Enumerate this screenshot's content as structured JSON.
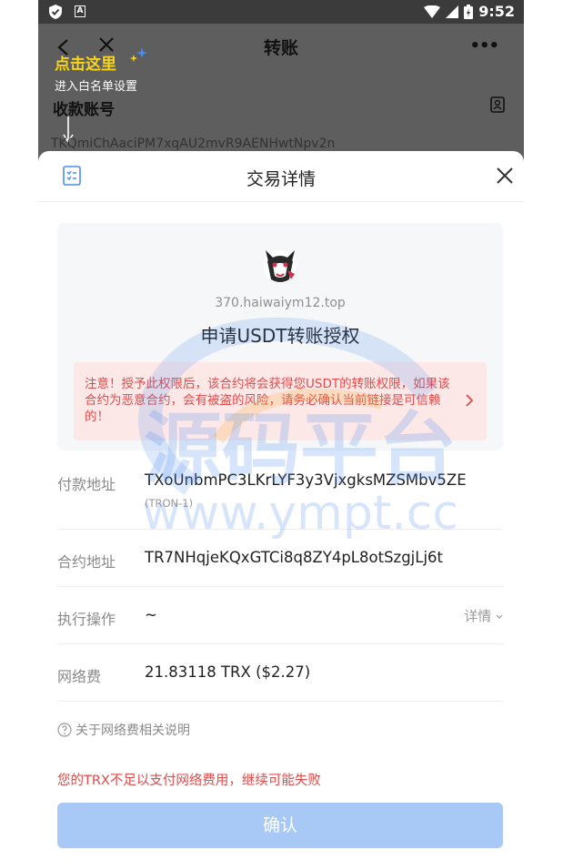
{
  "status_bar": {
    "time": "9:52",
    "app_badge": "A"
  },
  "background_page": {
    "title": "转账",
    "hint_title": "点击这里",
    "hint_sub": "进入白名单设置",
    "section_label": "收款账号",
    "address_partial": "TKQmiChAaciPM7xqAU2mvR9AENHwtNpv2n",
    "more_label": "•••"
  },
  "sheet": {
    "title": "交易详情",
    "dapp_domain": "370.haiwaiym12.top",
    "request_title": "申请USDT转账授权",
    "warning": "注意！授予此权限后，该合约将会获得您USDT的转账权限，如果该合约为恶意合约，会有被盗的风险，请务必确认当前链接是可信赖的！",
    "rows": {
      "payer_label": "付款地址",
      "payer_value": "TXoUnbmPC3LKrLYF3y3VjxgksMZSMbv5ZE",
      "payer_network": "(TRON-1)",
      "contract_label": "合约地址",
      "contract_value": "TR7NHqjeKQxGTCi8q8ZY4pL8otSzgjLj6t",
      "action_label": "执行操作",
      "action_value": "~",
      "action_detail": "详情",
      "fee_label": "网络费",
      "fee_value": "21.83118 TRX ($2.27)"
    },
    "fee_help": "关于网络费相关说明",
    "fee_warning": "您的TRX不足以支付网络费用，继续可能失败",
    "confirm_label": "确认"
  },
  "watermark": {
    "brand": "源码平台",
    "url": "www.ympt.cc"
  },
  "colors": {
    "accent_blue": "#a8c8f6",
    "warning_red": "#e24a4a",
    "warning_bg": "#fde8e8",
    "hint_yellow": "#f7d417"
  }
}
